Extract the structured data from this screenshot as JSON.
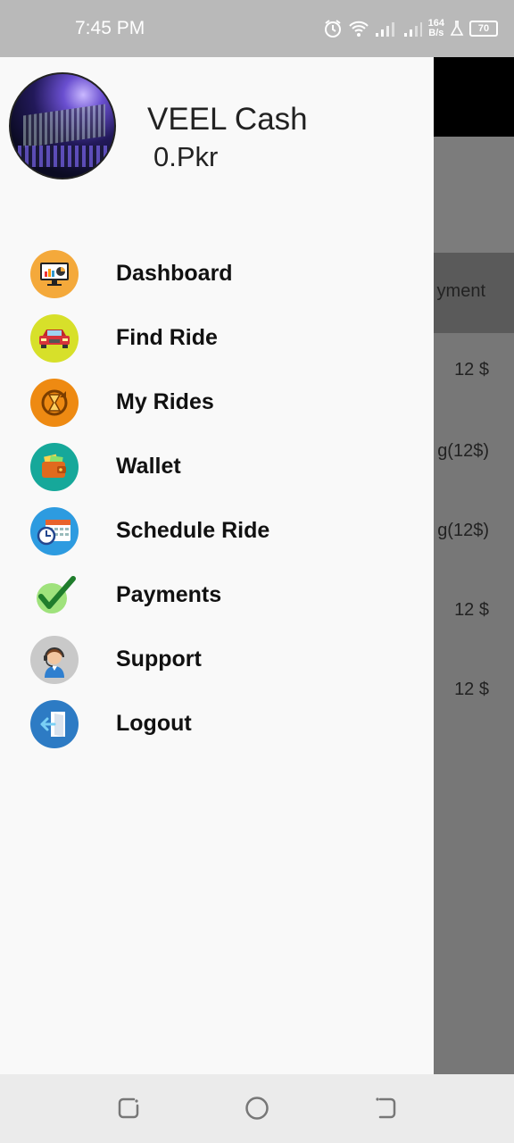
{
  "status_bar": {
    "time": "7:45 PM",
    "net_speed_value": "164",
    "net_speed_unit": "B/s",
    "battery": "70"
  },
  "drawer": {
    "user_name": "VEEL Cash",
    "balance": "0.Pkr",
    "menu": [
      {
        "label": "Dashboard",
        "icon": "dashboard-icon"
      },
      {
        "label": "Find Ride",
        "icon": "car-icon"
      },
      {
        "label": "My Rides",
        "icon": "hourglass-icon"
      },
      {
        "label": "Wallet",
        "icon": "wallet-icon"
      },
      {
        "label": "Schedule Ride",
        "icon": "calendar-icon"
      },
      {
        "label": "Payments",
        "icon": "checkmark-icon"
      },
      {
        "label": "Support",
        "icon": "support-agent-icon"
      },
      {
        "label": "Logout",
        "icon": "logout-door-icon"
      }
    ]
  },
  "background_screen": {
    "header_text": "yment",
    "cells": [
      "12 $",
      "g(12$)",
      "g(12$)",
      "12 $",
      "12 $"
    ]
  },
  "colors": {
    "drawer_bg": "#f9f9f9",
    "scrim": "#777777",
    "status_bar": "#b9b9b9"
  }
}
